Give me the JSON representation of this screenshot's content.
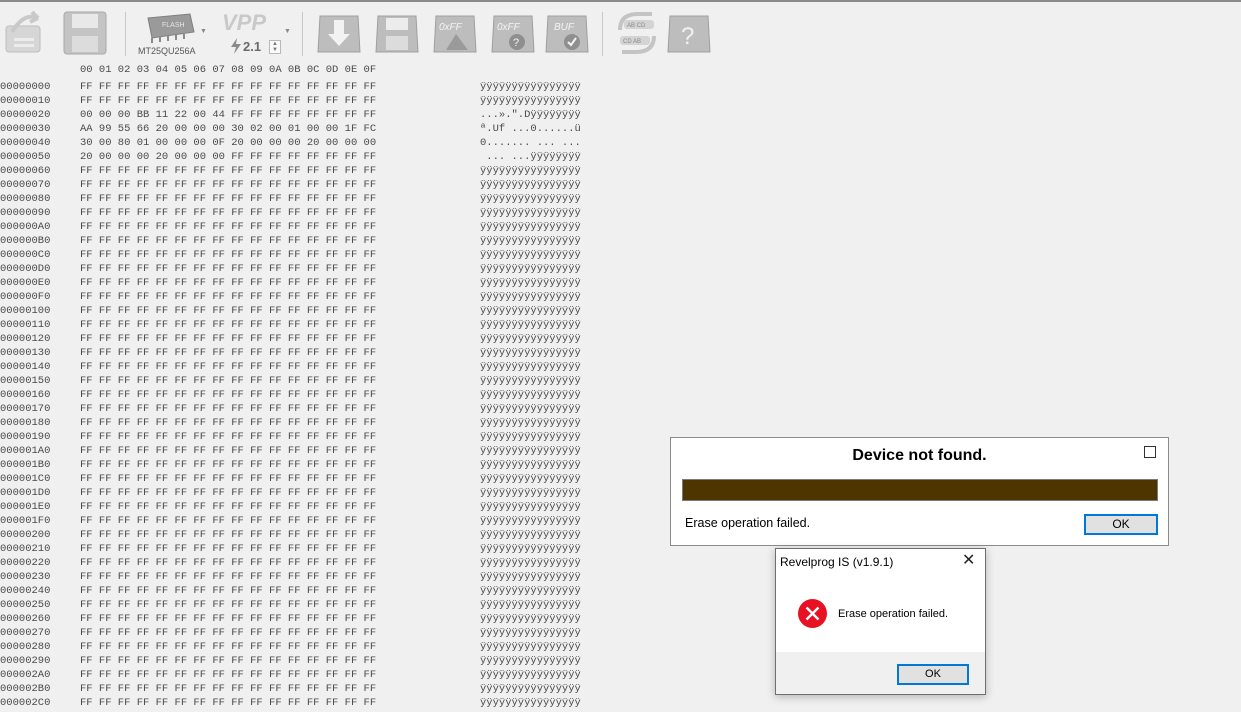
{
  "toolbar": {
    "chip_name": "MT25QU256A",
    "chip_badge": "FLASH",
    "vpp_label": "VPP",
    "vpp_value": "2.1",
    "fill_ff_label": "0xFF",
    "check_ff_label": "0xFF",
    "buffer_label": "BUF",
    "swap_top": "AB CD",
    "swap_bottom": "CD AB",
    "help_label": "?"
  },
  "hex_view": {
    "header": "00 01 02 03 04 05 06 07 08 09 0A 0B 0C 0D 0E 0F",
    "rows": [
      {
        "addr": "00000000",
        "bytes": "FF FF FF FF FF FF FF FF FF FF FF FF FF FF FF FF",
        "ascii": "ÿÿÿÿÿÿÿÿÿÿÿÿÿÿÿÿ"
      },
      {
        "addr": "00000010",
        "bytes": "FF FF FF FF FF FF FF FF FF FF FF FF FF FF FF FF",
        "ascii": "ÿÿÿÿÿÿÿÿÿÿÿÿÿÿÿÿ"
      },
      {
        "addr": "00000020",
        "bytes": "00 00 00 BB 11 22 00 44 FF FF FF FF FF FF FF FF",
        "ascii": "...».\".Dÿÿÿÿÿÿÿÿ"
      },
      {
        "addr": "00000030",
        "bytes": "AA 99 55 66 20 00 00 00 30 02 00 01 00 00 1F FC",
        "ascii": "ª.Uf ...0......ü"
      },
      {
        "addr": "00000040",
        "bytes": "30 00 80 01 00 00 00 0F 20 00 00 00 20 00 00 00",
        "ascii": "0....... ... ..."
      },
      {
        "addr": "00000050",
        "bytes": "20 00 00 00 20 00 00 00 FF FF FF FF FF FF FF FF",
        "ascii": " ... ...ÿÿÿÿÿÿÿÿ"
      },
      {
        "addr": "00000060",
        "bytes": "FF FF FF FF FF FF FF FF FF FF FF FF FF FF FF FF",
        "ascii": "ÿÿÿÿÿÿÿÿÿÿÿÿÿÿÿÿ"
      },
      {
        "addr": "00000070",
        "bytes": "FF FF FF FF FF FF FF FF FF FF FF FF FF FF FF FF",
        "ascii": "ÿÿÿÿÿÿÿÿÿÿÿÿÿÿÿÿ"
      },
      {
        "addr": "00000080",
        "bytes": "FF FF FF FF FF FF FF FF FF FF FF FF FF FF FF FF",
        "ascii": "ÿÿÿÿÿÿÿÿÿÿÿÿÿÿÿÿ"
      },
      {
        "addr": "00000090",
        "bytes": "FF FF FF FF FF FF FF FF FF FF FF FF FF FF FF FF",
        "ascii": "ÿÿÿÿÿÿÿÿÿÿÿÿÿÿÿÿ"
      },
      {
        "addr": "000000A0",
        "bytes": "FF FF FF FF FF FF FF FF FF FF FF FF FF FF FF FF",
        "ascii": "ÿÿÿÿÿÿÿÿÿÿÿÿÿÿÿÿ"
      },
      {
        "addr": "000000B0",
        "bytes": "FF FF FF FF FF FF FF FF FF FF FF FF FF FF FF FF",
        "ascii": "ÿÿÿÿÿÿÿÿÿÿÿÿÿÿÿÿ"
      },
      {
        "addr": "000000C0",
        "bytes": "FF FF FF FF FF FF FF FF FF FF FF FF FF FF FF FF",
        "ascii": "ÿÿÿÿÿÿÿÿÿÿÿÿÿÿÿÿ"
      },
      {
        "addr": "000000D0",
        "bytes": "FF FF FF FF FF FF FF FF FF FF FF FF FF FF FF FF",
        "ascii": "ÿÿÿÿÿÿÿÿÿÿÿÿÿÿÿÿ"
      },
      {
        "addr": "000000E0",
        "bytes": "FF FF FF FF FF FF FF FF FF FF FF FF FF FF FF FF",
        "ascii": "ÿÿÿÿÿÿÿÿÿÿÿÿÿÿÿÿ"
      },
      {
        "addr": "000000F0",
        "bytes": "FF FF FF FF FF FF FF FF FF FF FF FF FF FF FF FF",
        "ascii": "ÿÿÿÿÿÿÿÿÿÿÿÿÿÿÿÿ"
      },
      {
        "addr": "00000100",
        "bytes": "FF FF FF FF FF FF FF FF FF FF FF FF FF FF FF FF",
        "ascii": "ÿÿÿÿÿÿÿÿÿÿÿÿÿÿÿÿ"
      },
      {
        "addr": "00000110",
        "bytes": "FF FF FF FF FF FF FF FF FF FF FF FF FF FF FF FF",
        "ascii": "ÿÿÿÿÿÿÿÿÿÿÿÿÿÿÿÿ"
      },
      {
        "addr": "00000120",
        "bytes": "FF FF FF FF FF FF FF FF FF FF FF FF FF FF FF FF",
        "ascii": "ÿÿÿÿÿÿÿÿÿÿÿÿÿÿÿÿ"
      },
      {
        "addr": "00000130",
        "bytes": "FF FF FF FF FF FF FF FF FF FF FF FF FF FF FF FF",
        "ascii": "ÿÿÿÿÿÿÿÿÿÿÿÿÿÿÿÿ"
      },
      {
        "addr": "00000140",
        "bytes": "FF FF FF FF FF FF FF FF FF FF FF FF FF FF FF FF",
        "ascii": "ÿÿÿÿÿÿÿÿÿÿÿÿÿÿÿÿ"
      },
      {
        "addr": "00000150",
        "bytes": "FF FF FF FF FF FF FF FF FF FF FF FF FF FF FF FF",
        "ascii": "ÿÿÿÿÿÿÿÿÿÿÿÿÿÿÿÿ"
      },
      {
        "addr": "00000160",
        "bytes": "FF FF FF FF FF FF FF FF FF FF FF FF FF FF FF FF",
        "ascii": "ÿÿÿÿÿÿÿÿÿÿÿÿÿÿÿÿ"
      },
      {
        "addr": "00000170",
        "bytes": "FF FF FF FF FF FF FF FF FF FF FF FF FF FF FF FF",
        "ascii": "ÿÿÿÿÿÿÿÿÿÿÿÿÿÿÿÿ"
      },
      {
        "addr": "00000180",
        "bytes": "FF FF FF FF FF FF FF FF FF FF FF FF FF FF FF FF",
        "ascii": "ÿÿÿÿÿÿÿÿÿÿÿÿÿÿÿÿ"
      },
      {
        "addr": "00000190",
        "bytes": "FF FF FF FF FF FF FF FF FF FF FF FF FF FF FF FF",
        "ascii": "ÿÿÿÿÿÿÿÿÿÿÿÿÿÿÿÿ"
      },
      {
        "addr": "000001A0",
        "bytes": "FF FF FF FF FF FF FF FF FF FF FF FF FF FF FF FF",
        "ascii": "ÿÿÿÿÿÿÿÿÿÿÿÿÿÿÿÿ"
      },
      {
        "addr": "000001B0",
        "bytes": "FF FF FF FF FF FF FF FF FF FF FF FF FF FF FF FF",
        "ascii": "ÿÿÿÿÿÿÿÿÿÿÿÿÿÿÿÿ"
      },
      {
        "addr": "000001C0",
        "bytes": "FF FF FF FF FF FF FF FF FF FF FF FF FF FF FF FF",
        "ascii": "ÿÿÿÿÿÿÿÿÿÿÿÿÿÿÿÿ"
      },
      {
        "addr": "000001D0",
        "bytes": "FF FF FF FF FF FF FF FF FF FF FF FF FF FF FF FF",
        "ascii": "ÿÿÿÿÿÿÿÿÿÿÿÿÿÿÿÿ"
      },
      {
        "addr": "000001E0",
        "bytes": "FF FF FF FF FF FF FF FF FF FF FF FF FF FF FF FF",
        "ascii": "ÿÿÿÿÿÿÿÿÿÿÿÿÿÿÿÿ"
      },
      {
        "addr": "000001F0",
        "bytes": "FF FF FF FF FF FF FF FF FF FF FF FF FF FF FF FF",
        "ascii": "ÿÿÿÿÿÿÿÿÿÿÿÿÿÿÿÿ"
      },
      {
        "addr": "00000200",
        "bytes": "FF FF FF FF FF FF FF FF FF FF FF FF FF FF FF FF",
        "ascii": "ÿÿÿÿÿÿÿÿÿÿÿÿÿÿÿÿ"
      },
      {
        "addr": "00000210",
        "bytes": "FF FF FF FF FF FF FF FF FF FF FF FF FF FF FF FF",
        "ascii": "ÿÿÿÿÿÿÿÿÿÿÿÿÿÿÿÿ"
      },
      {
        "addr": "00000220",
        "bytes": "FF FF FF FF FF FF FF FF FF FF FF FF FF FF FF FF",
        "ascii": "ÿÿÿÿÿÿÿÿÿÿÿÿÿÿÿÿ"
      },
      {
        "addr": "00000230",
        "bytes": "FF FF FF FF FF FF FF FF FF FF FF FF FF FF FF FF",
        "ascii": "ÿÿÿÿÿÿÿÿÿÿÿÿÿÿÿÿ"
      },
      {
        "addr": "00000240",
        "bytes": "FF FF FF FF FF FF FF FF FF FF FF FF FF FF FF FF",
        "ascii": "ÿÿÿÿÿÿÿÿÿÿÿÿÿÿÿÿ"
      },
      {
        "addr": "00000250",
        "bytes": "FF FF FF FF FF FF FF FF FF FF FF FF FF FF FF FF",
        "ascii": "ÿÿÿÿÿÿÿÿÿÿÿÿÿÿÿÿ"
      },
      {
        "addr": "00000260",
        "bytes": "FF FF FF FF FF FF FF FF FF FF FF FF FF FF FF FF",
        "ascii": "ÿÿÿÿÿÿÿÿÿÿÿÿÿÿÿÿ"
      },
      {
        "addr": "00000270",
        "bytes": "FF FF FF FF FF FF FF FF FF FF FF FF FF FF FF FF",
        "ascii": "ÿÿÿÿÿÿÿÿÿÿÿÿÿÿÿÿ"
      },
      {
        "addr": "00000280",
        "bytes": "FF FF FF FF FF FF FF FF FF FF FF FF FF FF FF FF",
        "ascii": "ÿÿÿÿÿÿÿÿÿÿÿÿÿÿÿÿ"
      },
      {
        "addr": "00000290",
        "bytes": "FF FF FF FF FF FF FF FF FF FF FF FF FF FF FF FF",
        "ascii": "ÿÿÿÿÿÿÿÿÿÿÿÿÿÿÿÿ"
      },
      {
        "addr": "000002A0",
        "bytes": "FF FF FF FF FF FF FF FF FF FF FF FF FF FF FF FF",
        "ascii": "ÿÿÿÿÿÿÿÿÿÿÿÿÿÿÿÿ"
      },
      {
        "addr": "000002B0",
        "bytes": "FF FF FF FF FF FF FF FF FF FF FF FF FF FF FF FF",
        "ascii": "ÿÿÿÿÿÿÿÿÿÿÿÿÿÿÿÿ"
      },
      {
        "addr": "000002C0",
        "bytes": "FF FF FF FF FF FF FF FF FF FF FF FF FF FF FF FF",
        "ascii": "ÿÿÿÿÿÿÿÿÿÿÿÿÿÿÿÿ"
      }
    ]
  },
  "device_panel": {
    "title": "Device not found.",
    "message": "Erase operation failed.",
    "ok_label": "OK",
    "progress_color": "#4e3500"
  },
  "message_box": {
    "caption": "Revelprog IS (v1.9.1)",
    "close_glyph": "✕",
    "text": "Erase operation failed.",
    "ok_label": "OK",
    "error_color": "#e81123"
  }
}
